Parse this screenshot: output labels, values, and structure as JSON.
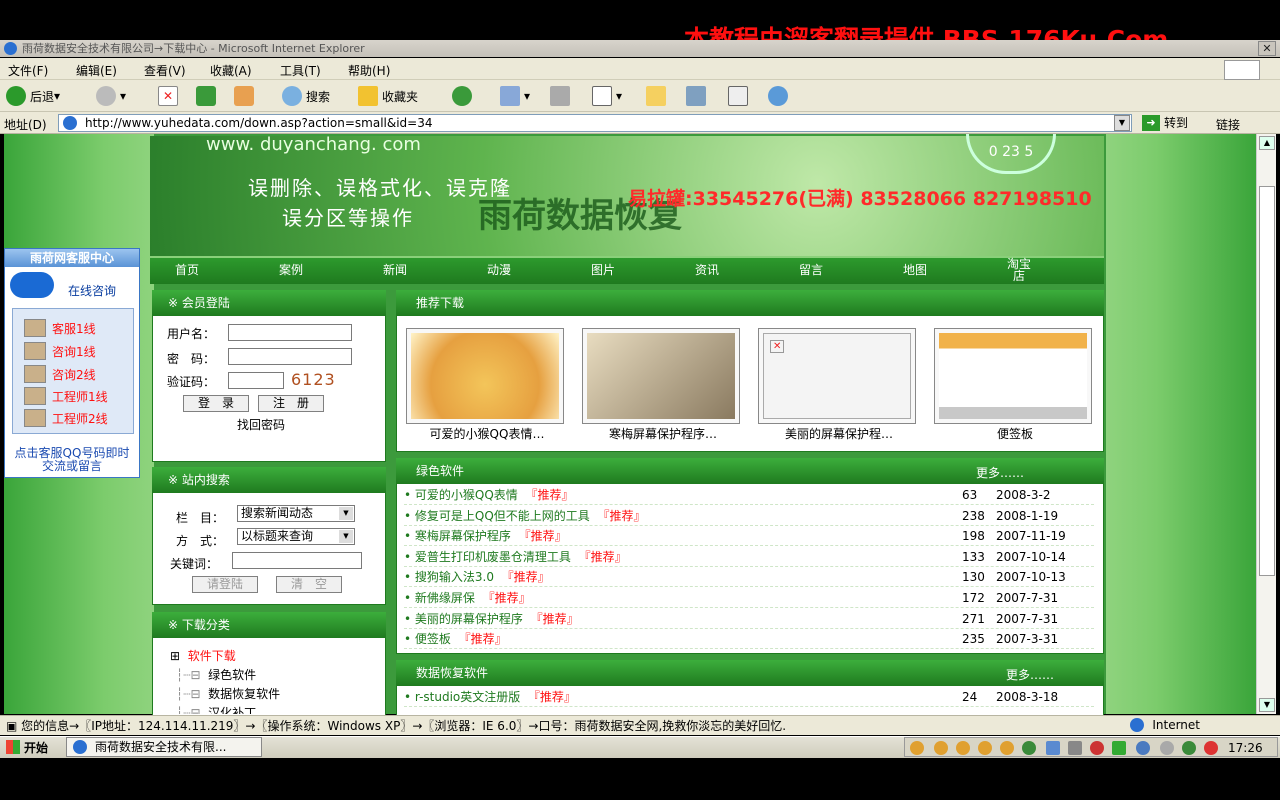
{
  "watermark": "本教程由溜客翻录提供 BBS.176Ku.Com",
  "window": {
    "title": "雨荷数据安全技术有限公司→下载中心 - Microsoft Internet Explorer",
    "close": "✕"
  },
  "menu": [
    "文件(F)",
    "编辑(E)",
    "查看(V)",
    "收藏(A)",
    "工具(T)",
    "帮助(H)"
  ],
  "toolbar": {
    "back": "后退",
    "search": "搜索",
    "favorites": "收藏夹"
  },
  "address": {
    "label": "地址(D)",
    "url": "http://www.yuhedata.com/down.asp?action=small&id=34",
    "go": "转到",
    "links": "链接"
  },
  "banner": {
    "url": "www. duyanchang. com",
    "line1": "误删除、误格式化、误克隆",
    "line2": "误分区等操作",
    "brand": "雨荷数据恢复",
    "clock": "0 23 5",
    "qq": "易拉罐:33545276(已满) 83528066 827198510"
  },
  "nav": [
    "首页",
    "案例",
    "新闻",
    "动漫",
    "图片",
    "资讯",
    "留言",
    "地图",
    "淘宝店"
  ],
  "kefu": {
    "title": "雨荷网客服中心",
    "online": "在线咨询",
    "lines": [
      "客服1线",
      "咨询1线",
      "咨询2线",
      "工程师1线",
      "工程师2线"
    ],
    "footer": "点击客服QQ号码即时交流或留言"
  },
  "login": {
    "title": "※ 会员登陆",
    "user_label": "用户名：",
    "pass_label": "密　码：",
    "code_label": "验证码：",
    "code": "6123",
    "login_btn": "登　录",
    "reg_btn": "注　册",
    "forgot": "找回密码"
  },
  "search": {
    "title": "※ 站内搜索",
    "col_label": "栏　目：",
    "col_value": "搜索新闻动态",
    "mode_label": "方　式：",
    "mode_value": "以标题来查询",
    "kw_label": "关键词：",
    "submit": "请登陆",
    "clear": "清　空"
  },
  "categories": {
    "title": "※ 下载分类",
    "root": "软件下载",
    "items": [
      "绿色软件",
      "数据恢复软件",
      "汉化补丁"
    ]
  },
  "recommend": {
    "title": "推荐下载",
    "items": [
      {
        "caption": "可爱的小猴QQ表情…",
        "color": "#f3c55a"
      },
      {
        "caption": "寒梅屏幕保护程序…",
        "color": "#d9cdb0"
      },
      {
        "caption": "美丽的屏幕保护程…",
        "color": "#f4f4f4"
      },
      {
        "caption": "便签板",
        "color": "#f1b24a"
      }
    ]
  },
  "green": {
    "title": "绿色软件",
    "more": "更多……",
    "tag": "『推荐』",
    "rows": [
      {
        "title": "可爱的小猴QQ表情",
        "count": "63",
        "date": "2008-3-2"
      },
      {
        "title": "修复可是上QQ但不能上网的工具",
        "count": "238",
        "date": "2008-1-19"
      },
      {
        "title": "寒梅屏幕保护程序",
        "count": "198",
        "date": "2007-11-19"
      },
      {
        "title": "爱普生打印机废墨仓清理工具",
        "count": "133",
        "date": "2007-10-14"
      },
      {
        "title": "搜狗输入法3.0",
        "count": "130",
        "date": "2007-10-13"
      },
      {
        "title": "新佛缘屏保",
        "count": "172",
        "date": "2007-7-31"
      },
      {
        "title": "美丽的屏幕保护程序",
        "count": "271",
        "date": "2007-7-31"
      },
      {
        "title": "便签板",
        "count": "235",
        "date": "2007-3-31"
      }
    ]
  },
  "recovery": {
    "title": "数据恢复软件",
    "more": "更多……",
    "tag": "『推荐』",
    "rows": [
      {
        "title": "r-studio英文注册版",
        "count": "24",
        "date": "2008-3-18"
      }
    ]
  },
  "status": {
    "text": "您的信息→〖IP地址：124.114.11.219〗→〖操作系统：Windows XP〗→〖浏览器：IE 6.0〗→口号：雨荷数据安全网,挽救你淡忘的美好回忆.",
    "zone": "Internet"
  },
  "taskbar": {
    "start": "开始",
    "task": "雨荷数据安全技术有限...",
    "time": "17:26"
  }
}
